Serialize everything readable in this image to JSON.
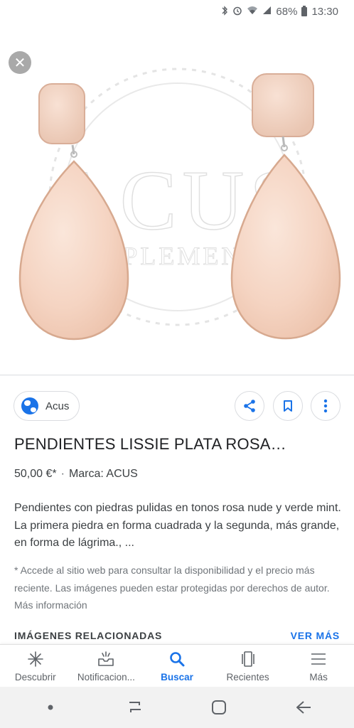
{
  "status_bar": {
    "battery_percent": "68%",
    "time": "13:30",
    "icons": [
      "bluetooth-icon",
      "alarm-icon",
      "wifi-icon",
      "signal-icon",
      "battery-icon"
    ]
  },
  "viewer": {
    "close_icon": "close-icon",
    "watermark_text": "ACUS",
    "watermark_subtext": "COMPLEMENTOS"
  },
  "details": {
    "source": "Acus",
    "title": "PENDIENTES LISSIE PLATA ROSA…",
    "price": "50,00 €*",
    "separator": "·",
    "brand": "Marca: ACUS",
    "description": "Pendientes con piedras pulidas en tonos rosa nude y verde mint. La primera piedra en forma cuadrada y la segunda, más grande, en forma de lágrima., ...",
    "disclaimer": "* Accede al sitio web para consultar la disponibilidad y el precio más reciente. Las imágenes pueden estar protegidas por derechos de autor. Más información",
    "related_header": "IMÁGENES RELACIONADAS",
    "see_more": "VER MÁS"
  },
  "bottom_nav": {
    "items": [
      {
        "label": "Descubrir",
        "icon": "asterisk-icon",
        "active": false
      },
      {
        "label": "Notificacion...",
        "icon": "inbox-icon",
        "active": false
      },
      {
        "label": "Buscar",
        "icon": "search-icon",
        "active": true
      },
      {
        "label": "Recientes",
        "icon": "recent-cards-icon",
        "active": false
      },
      {
        "label": "Más",
        "icon": "menu-icon",
        "active": false
      }
    ]
  },
  "colors": {
    "accent": "#1a73e8",
    "text_primary": "#202124",
    "text_secondary": "#70757a",
    "stone_pink": "#f6d5c3"
  }
}
